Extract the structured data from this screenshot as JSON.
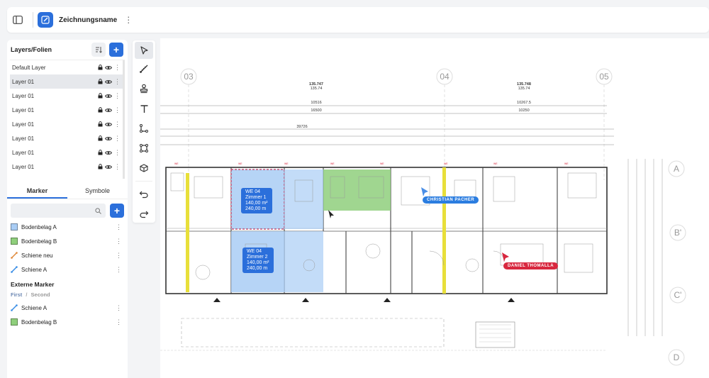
{
  "header": {
    "drawing_name": "Zeichnungsname",
    "colors": {
      "accent": "#2b6fdb"
    }
  },
  "layers_panel": {
    "title": "Layers/Folien",
    "items": [
      {
        "label": "Default Layer",
        "selected": false
      },
      {
        "label": "Layer 01",
        "selected": true
      },
      {
        "label": "Layer 01",
        "selected": false
      },
      {
        "label": "Layer 01",
        "selected": false
      },
      {
        "label": "Layer 01",
        "selected": false
      },
      {
        "label": "Layer 01",
        "selected": false
      },
      {
        "label": "Layer 01",
        "selected": false
      },
      {
        "label": "Layer 01",
        "selected": false
      }
    ]
  },
  "tabs": {
    "marker": "Marker",
    "symbole": "Symbole",
    "active": "Marker"
  },
  "markers": [
    {
      "label": "Bodenbelag A",
      "type": "area",
      "color": "#a9cdf5"
    },
    {
      "label": "Bodenbelag B",
      "type": "area",
      "color": "#8fcf7c"
    },
    {
      "label": "Schiene neu",
      "type": "line",
      "color": "#e08a3c"
    },
    {
      "label": "Schiene A",
      "type": "line",
      "color": "#3a8ee6"
    }
  ],
  "external": {
    "title": "Externe Marker",
    "first": "First",
    "second": "Second",
    "items": [
      {
        "label": "Schiene A",
        "type": "line",
        "color": "#3a8ee6"
      },
      {
        "label": "Bodenbelag B",
        "type": "area",
        "color": "#8fcf7c"
      }
    ]
  },
  "tools": [
    "select-tool",
    "measure-tool",
    "stamp-tool",
    "text-tool",
    "polyline-tool",
    "rectangle-tool",
    "cube-tool",
    "undo-tool",
    "redo-tool"
  ],
  "drawing": {
    "axes_top": [
      "03",
      "04",
      "05"
    ],
    "axes_right": [
      "A",
      "B'",
      "C'",
      "D"
    ],
    "dims": {
      "d1_top": "135.747",
      "d1_bottom": "135.74",
      "d2_top": "135.748",
      "d2_bottom": "135.74",
      "span1": "10516",
      "span1b": "16500",
      "span2": "10267.5",
      "span2b": "10250",
      "total": "39726"
    },
    "rooms": [
      {
        "line1": "WE 04",
        "line2": "Zimmer 1",
        "line3": "140,00 m²",
        "line4": "240,00 m"
      },
      {
        "line1": "WE 04",
        "line2": "Zimmer 2",
        "line3": "140,00 m²",
        "line4": "240,00 m"
      }
    ],
    "cursors": [
      {
        "name": "CHRISTIAN PACHER",
        "color": "#2b7de0"
      },
      {
        "name": "DANIEL THOMALLA",
        "color": "#d8283f"
      }
    ]
  }
}
